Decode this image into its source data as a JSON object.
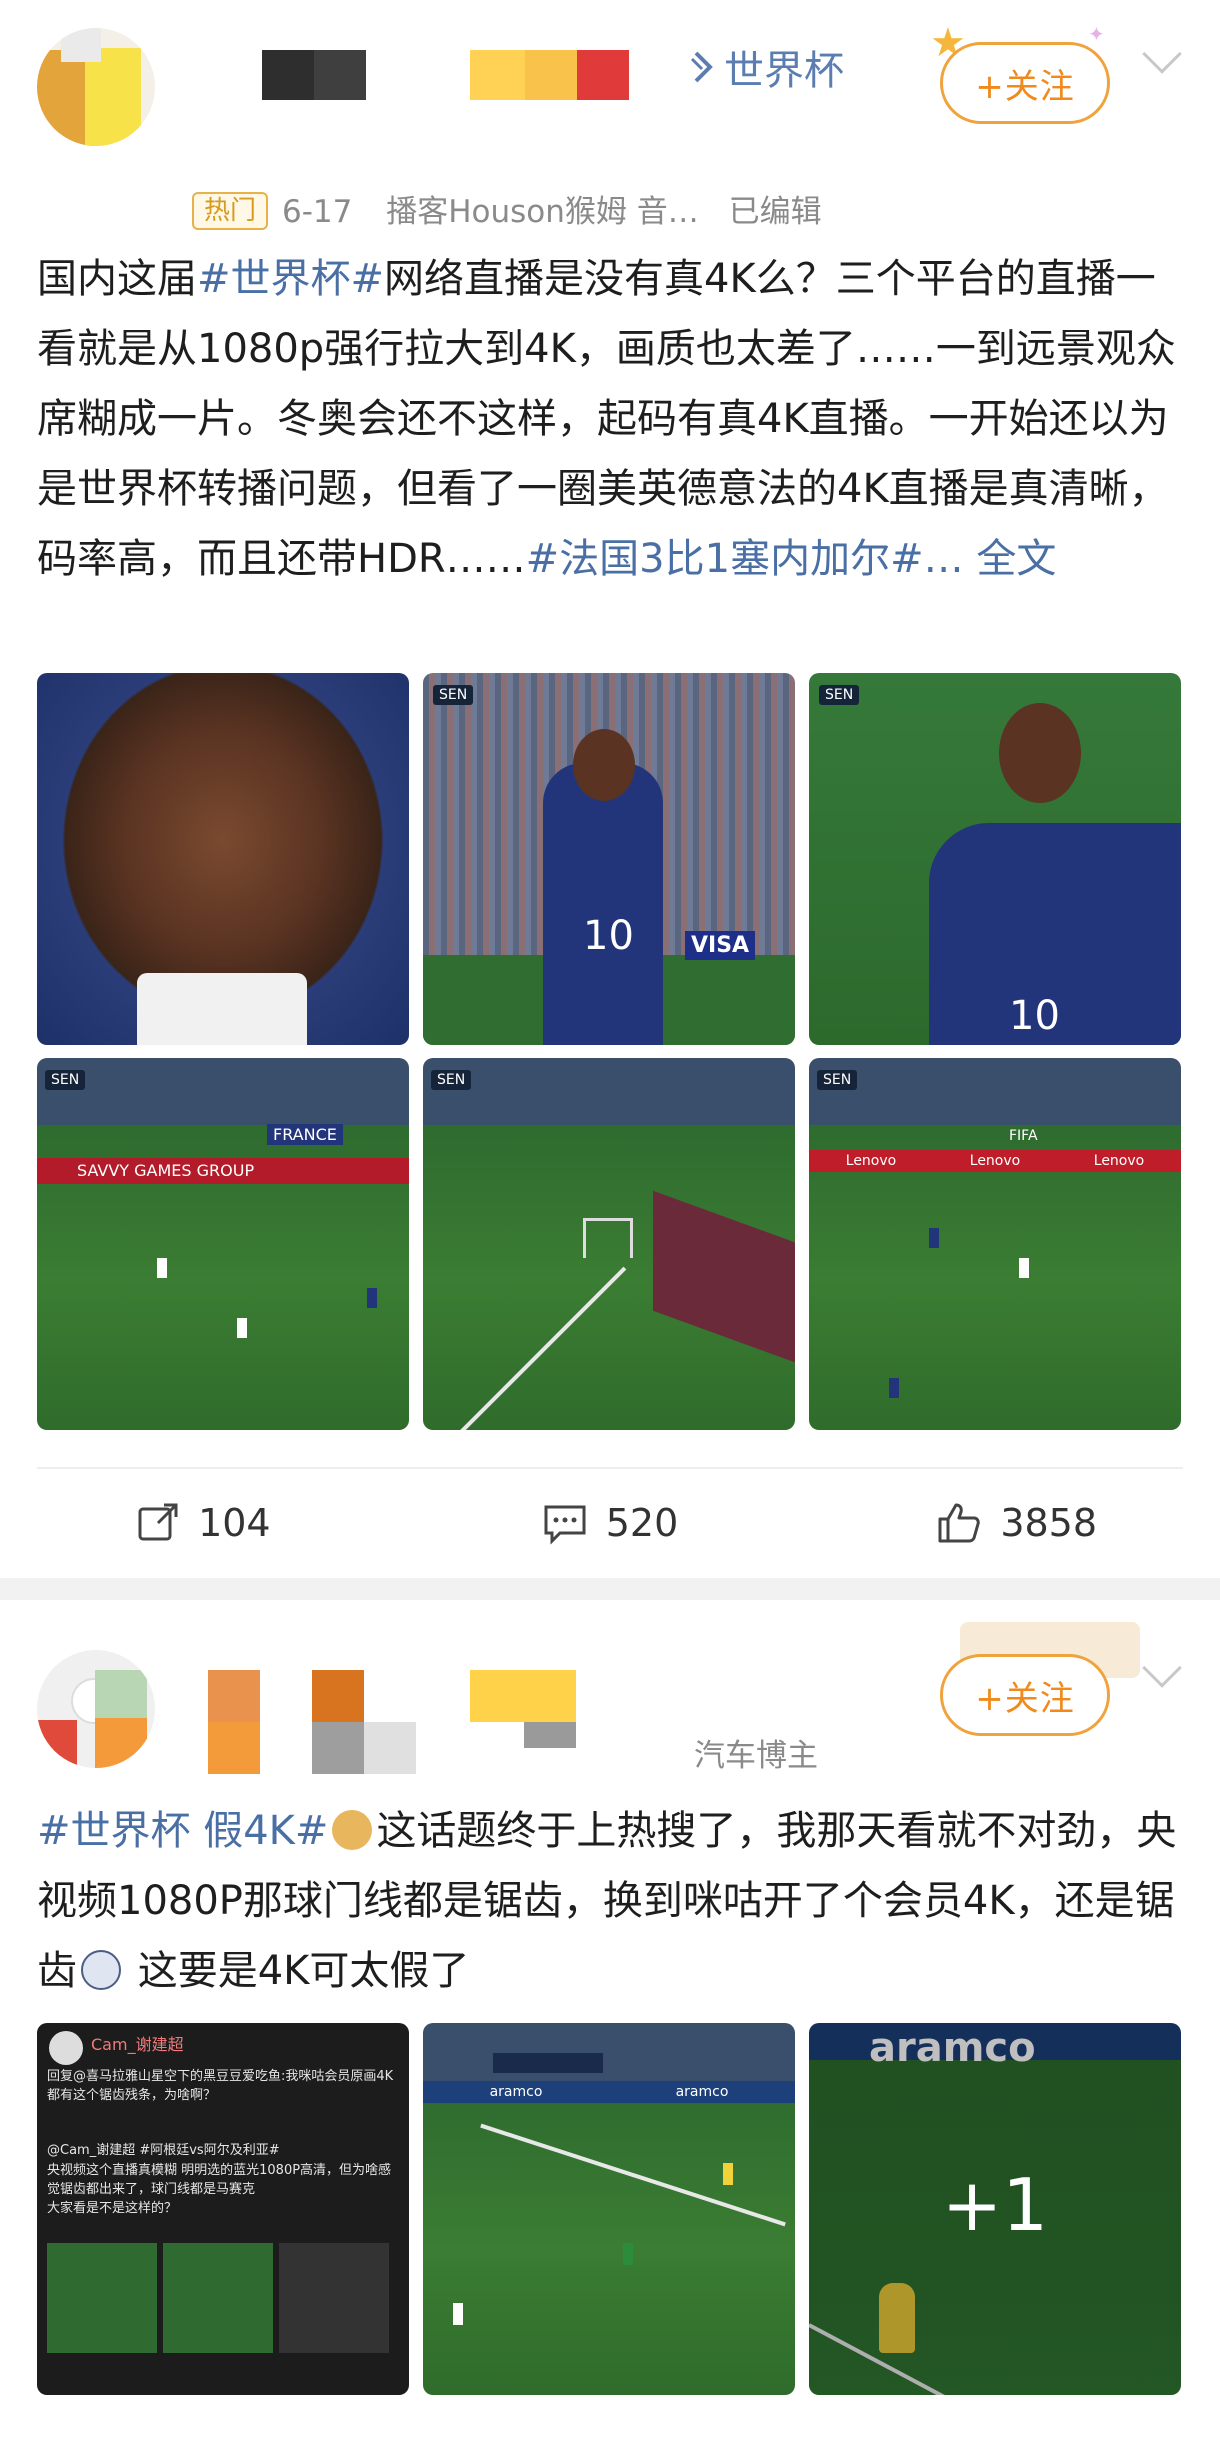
{
  "post1": {
    "topic_link": "世界杯",
    "follow_label": "+关注",
    "badge": "热门",
    "date": "6-17",
    "source": "播客Houson猴姆 音…",
    "edited": "已编辑",
    "text_parts": {
      "p1": "国内这届",
      "tag1": "#世界杯#",
      "p2": "网络直播是没有真4K么？三个平台的直播一看就是从1080p强行拉大到4K，画质也太差了……一到远景观众席糊成一片。冬奥会还不这样，起码有真4K直播。一开始还以为是世界杯转播问题，但看了一圈美英德意法的4K直播是真清晰，码率高，而且还带HDR……",
      "tag2": "#法国3比1塞内加尔#",
      "ellipsis": "… ",
      "full_text": "全文"
    },
    "image_overlay_texts": [
      "SEN",
      "10",
      "VISA",
      "SAVVY GAMES GROUP",
      "FRANCE",
      "Lenovo",
      "FIFA"
    ],
    "actions": {
      "repost": "104",
      "comment": "520",
      "like": "3858"
    }
  },
  "post2": {
    "follow_label": "+关注",
    "role": "汽车博主",
    "text_parts": {
      "tag1": "#世界杯 假4K#",
      "p1": "这话题终于上热搜了，我那天看就不对劲，央视频1080P那球门线都是锯齿，换到咪咕开了个会员4K，还是锯齿",
      "p2": " 这要是4K可太假了"
    },
    "image_overlay_texts": [
      "aramco",
      "+1"
    ],
    "image_more": "+1",
    "screenshot_lines": [
      "Cam_谢建超",
      "回复@喜马拉雅山星空下的黑豆豆爱吃鱼:我咪咕会员原画4K都有这个锯齿残条，为啥啊？",
      "@Cam_谢建超 #阿根廷vs阿尔及利亚#",
      "央视频这个直播真模糊 明明选的蓝光1080P高清，但为啥感觉锯齿都出来了，球门线都是马赛克",
      "大家看是不是这样的？"
    ]
  },
  "colors": {
    "accent_orange": "#f08a1c",
    "link_blue": "#4a6fa5",
    "badge_gold": "#d69a1f"
  },
  "icons": [
    "repost-icon",
    "comment-icon",
    "like-icon",
    "chevron-down-icon",
    "topic-icon"
  ]
}
